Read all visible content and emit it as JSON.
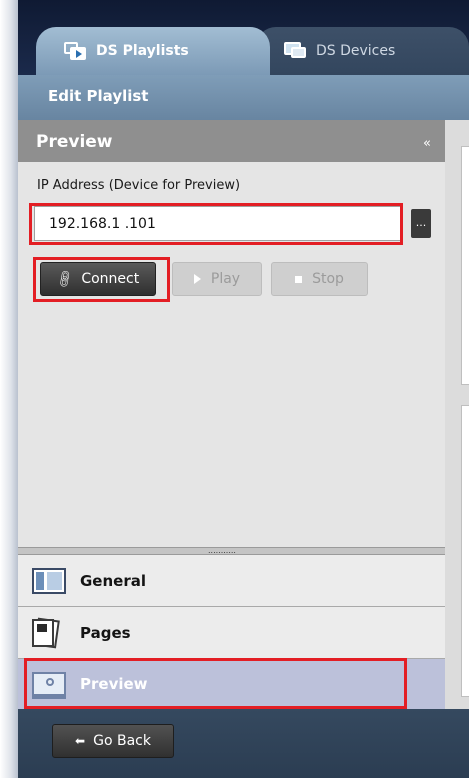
{
  "tabs": [
    {
      "label": "DS Playlists",
      "icon": "playlist-icon",
      "active": true
    },
    {
      "label": "DS Devices",
      "icon": "devices-icon",
      "active": false
    }
  ],
  "header": {
    "title": "Edit Playlist"
  },
  "panel": {
    "title": "Preview",
    "collapse_glyph": "«",
    "ip_label": "IP Address (Device for Preview)",
    "ip_value": "192.168.1 .101",
    "browse_label": "...",
    "buttons": {
      "connect": "Connect",
      "play": "Play",
      "stop": "Stop"
    },
    "splitter_dots": "..........."
  },
  "nav_items": [
    {
      "label": "General",
      "icon": "general-icon",
      "active": false
    },
    {
      "label": "Pages",
      "icon": "pages-icon",
      "active": false
    },
    {
      "label": "Preview",
      "icon": "preview-icon",
      "active": true
    }
  ],
  "footer": {
    "go_back": "Go Back"
  },
  "colors": {
    "highlight": "#e31e24",
    "active_tab": "#8fabc4",
    "header_band": "#7391ad",
    "panel_header": "#8f8f8f",
    "active_nav": "#bcc1da"
  }
}
